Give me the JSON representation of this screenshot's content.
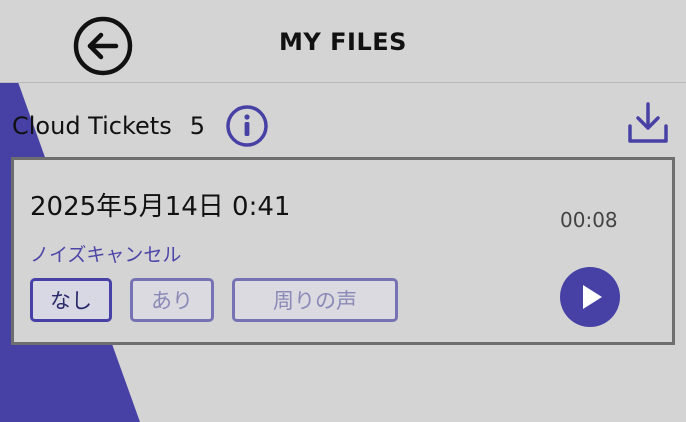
{
  "header": {
    "back_icon": "arrow-left-circle-icon",
    "title": "MY FILES"
  },
  "section": {
    "label": "Cloud Tickets",
    "count": "5",
    "info_icon": "info-circle-icon",
    "download_icon": "download-tray-icon"
  },
  "ticket": {
    "date": "2025年5月14日 0:41",
    "duration": "00:08",
    "noise_label": "ノイズキャンセル",
    "options": [
      "なし",
      "あり",
      "周りの声"
    ],
    "selected_option": "なし",
    "play_icon": "play-icon"
  },
  "colors": {
    "accent": "#4741a5",
    "background": "#d4d4d4",
    "card_border": "#6e6e6e"
  }
}
